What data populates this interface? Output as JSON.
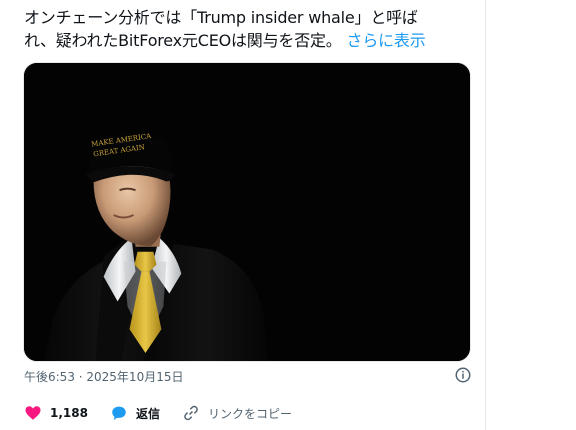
{
  "tweet": {
    "text_line1": "オンチェーン分析では「Trump insider whale」と呼ば",
    "text_line2": "れ、疑われたBitForex元CEOは関与を否定。",
    "show_more": "さらに表示",
    "cap_text_1": "MAKE AMERICA",
    "cap_text_2": "GREAT AGAIN",
    "timestamp": "午後6:53 · 2025年10月15日"
  },
  "actions": {
    "like_count": "1,188",
    "reply_label": "返信",
    "copy_link_label": "リンクをコピー"
  },
  "colors": {
    "like": "#f91880",
    "reply": "#1d9bf0",
    "link_blue": "#1d9bf0"
  }
}
